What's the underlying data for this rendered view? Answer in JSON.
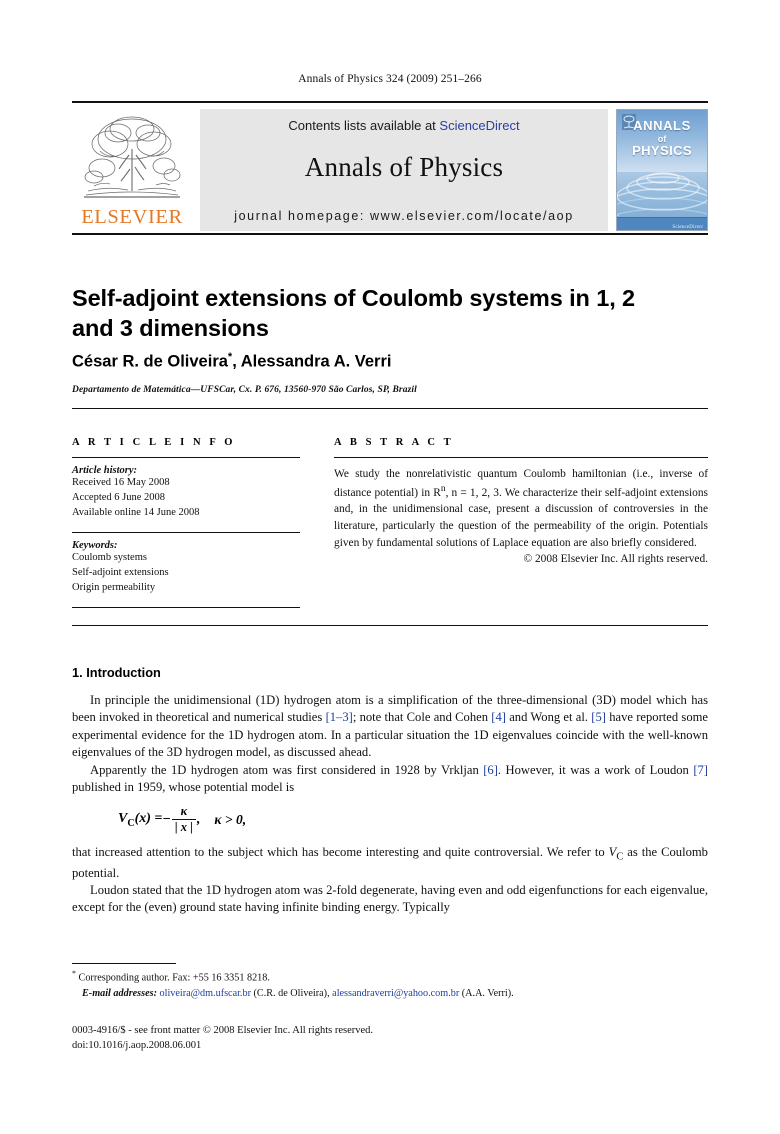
{
  "running_head": "Annals of Physics 324 (2009) 251–266",
  "masthead": {
    "publisher_logo_text": "ELSEVIER",
    "contents_prefix": "Contents lists available at ",
    "sciencedirect": "ScienceDirect",
    "journal_title": "Annals of Physics",
    "homepage": "journal homepage: www.elsevier.com/locate/aop",
    "cover": {
      "line1": "ANNALS",
      "line2": "of",
      "line3": "PHYSICS",
      "footer_mark": "ScienceDirect"
    }
  },
  "article": {
    "title": "Self-adjoint extensions of Coulomb systems in 1, 2 and 3 dimensions",
    "authors": "César R. de Oliveira",
    "authors_rest": ", Alessandra A. Verri",
    "corresponding_marker": "*",
    "affiliation": "Departamento de Matemática—UFSCar, Cx. P. 676, 13560-970 São Carlos, SP, Brazil"
  },
  "article_info": {
    "heading": "A R T I C L E   I N F O",
    "history_label": "Article history:",
    "history": [
      "Received 16 May 2008",
      "Accepted 6 June 2008",
      "Available online 14 June 2008"
    ],
    "keywords_label": "Keywords:",
    "keywords": [
      "Coulomb systems",
      "Self-adjoint extensions",
      "Origin permeability"
    ]
  },
  "abstract": {
    "heading": "A B S T R A C T",
    "text_part1": "We study the nonrelativistic quantum Coulomb hamiltonian (i.e., inverse of distance potential) in R",
    "superscript_n": "n",
    "text_part2": ", n = 1, 2, 3. We characterize their self-adjoint extensions and, in the unidimensional case, present a discussion of controversies in the literature, particularly the question of the permeability of the origin. Potentials given by fundamental solutions of Laplace equation are also briefly considered.",
    "copyright": "© 2008 Elsevier Inc. All rights reserved."
  },
  "body": {
    "section_number_title": "1. Introduction",
    "paragraph1_a": "In principle the unidimensional (1D) hydrogen atom is a simplification of the three-dimensional (3D) model which has been invoked in theoretical and numerical studies ",
    "ref_1_3": "[1–3]",
    "paragraph1_b": "; note that Cole and Cohen ",
    "ref_4": "[4]",
    "paragraph1_c": " and Wong et al. ",
    "ref_5": "[5]",
    "paragraph1_d": " have reported some experimental evidence for the 1D hydrogen atom. In a particular situation the 1D eigenvalues coincide with the well-known eigenvalues of the 3D hydrogen model, as discussed ahead.",
    "paragraph2_a": "Apparently the 1D hydrogen atom was first considered in 1928 by Vrkljan ",
    "ref_6": "[6]",
    "paragraph2_b": ". However, it was a work of Loudon ",
    "ref_7": "[7]",
    "paragraph2_c": " published in 1959, whose potential model is",
    "equation": {
      "lhs": "V",
      "lhs_sub": "C",
      "lhs_arg": "(x) =",
      "minus": "−",
      "numerator": "κ",
      "denominator": "| x |",
      "comma": ",",
      "condition": "κ > 0,"
    },
    "paragraph3_a": "that increased attention to the subject which has become interesting and quite controversial. We refer to ",
    "paragraph3_v": "V",
    "paragraph3_vsub": "C",
    "paragraph3_b": " as the Coulomb potential.",
    "paragraph4": "Loudon stated that the 1D hydrogen atom was 2-fold degenerate, having even and odd eigenfunctions for each eigenvalue, except for the (even) ground state having infinite binding energy. Typically"
  },
  "footer": {
    "corresponding_marker": "*",
    "corresponding": "Corresponding author. Fax: +55 16 3351 8218.",
    "email_label": "E-mail addresses:",
    "email1": "oliveira@dm.ufscar.br",
    "email1_owner": " (C.R. de Oliveira), ",
    "email2": "alessandraverri@yahoo.com.br",
    "email2_owner": " (A.A. Verri).",
    "issn_line": "0003-4916/$ - see front matter © 2008 Elsevier Inc. All rights reserved.",
    "doi_line": "doi:10.1016/j.aop.2008.06.001"
  },
  "colors": {
    "link_blue": "#1d3f9e",
    "sciencedirect_blue": "#2b3fa0",
    "elsevier_orange": "#E87722",
    "band_gray": "#e6e6e6"
  }
}
